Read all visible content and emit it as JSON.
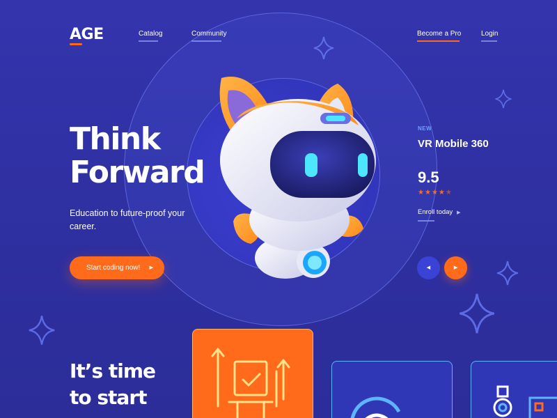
{
  "header": {
    "logo": "AGE",
    "nav": [
      {
        "label": "Catalog"
      },
      {
        "label": "Community"
      }
    ],
    "become_pro": "Become a Pro",
    "login": "Login"
  },
  "hero": {
    "title_line1": "Think",
    "title_line2": "Forward",
    "subtitle": "Education to future-proof your career.",
    "cta": "Start coding now!",
    "cta_icon": "play-arrow-icon"
  },
  "featured": {
    "tag": "NEW",
    "product": "VR Mobile 360",
    "score": "9.5",
    "rating_stars": 4.5,
    "enroll": "Enroll today",
    "prev_icon": "chevron-left-icon",
    "next_icon": "chevron-right-icon"
  },
  "section2": {
    "title_line1": "It’s time",
    "title_line2": "to start"
  },
  "colors": {
    "background": "#2f2fa2",
    "accent": "#ff6b1a",
    "secondary": "#3b42d6",
    "cyan": "#5fb4ff"
  }
}
